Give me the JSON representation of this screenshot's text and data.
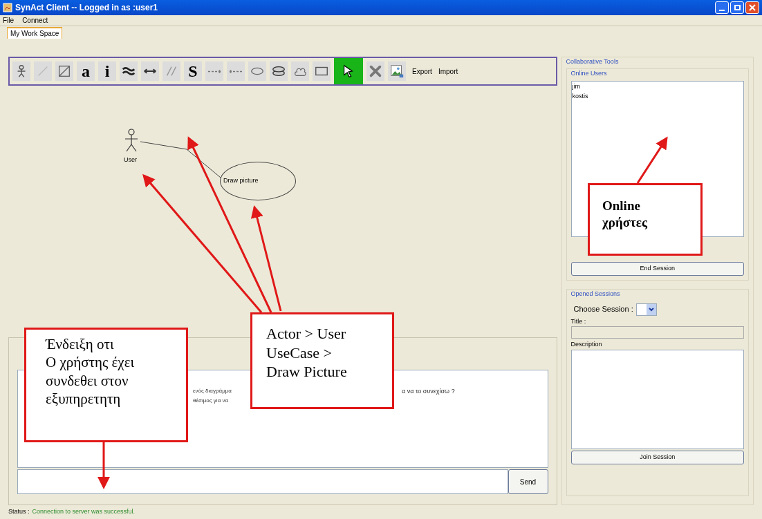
{
  "window": {
    "title": "SynAct Client -- Logged in as :user1"
  },
  "menu": [
    "File",
    "Connect"
  ],
  "tabs": [
    {
      "label": "My Work Space",
      "selected": true
    }
  ],
  "toolbar": [
    {
      "kind": "actor",
      "selected": false
    },
    {
      "kind": "faint-line",
      "selected": false
    },
    {
      "kind": "diagonal",
      "selected": false
    },
    {
      "kind": "glyph",
      "label": "a",
      "selected": false
    },
    {
      "kind": "glyph",
      "label": "i",
      "selected": false
    },
    {
      "kind": "wave",
      "selected": false
    },
    {
      "kind": "double-arrow",
      "selected": false
    },
    {
      "kind": "slashes",
      "selected": false
    },
    {
      "kind": "glyph",
      "label": "S",
      "selected": false
    },
    {
      "kind": "arrow-right",
      "selected": false
    },
    {
      "kind": "arrow-left",
      "selected": false
    },
    {
      "kind": "ellipse",
      "selected": false
    },
    {
      "kind": "stack",
      "selected": false
    },
    {
      "kind": "cloud",
      "selected": false
    },
    {
      "kind": "rectangle",
      "selected": false
    },
    {
      "kind": "pointer",
      "selected": true
    },
    {
      "kind": "delete",
      "selected": false
    },
    {
      "kind": "image",
      "selected": false
    }
  ],
  "toolbar_links": [
    "Export",
    "Import"
  ],
  "diagram": {
    "actor": "User",
    "usecase": "Draw picture"
  },
  "chat": {
    "lines": [
      {
        "left": "ενός διαγράμμα",
        "right": "α να το συνεχίσω ?"
      },
      {
        "left": "θέσιμος για να"
      }
    ],
    "send": "Send"
  },
  "status": {
    "label": "Status :",
    "message": "Connection to server was successful."
  },
  "collab": {
    "title": "Collaborative Tools",
    "online_title": "Online Users",
    "users": [
      "jim",
      "kostis"
    ],
    "end": "End Session",
    "sessions_title": "Opened Sessions",
    "choose": "Choose Session :",
    "title_label": "Title :",
    "description_label": "Description",
    "join": "Join Session"
  },
  "callouts": [
    {
      "kind": "plain",
      "lines": [
        "Ένδειξη οτι",
        "Ο χρήστης έχει",
        "συνδεθει στον",
        "εξυπηρετητη"
      ]
    },
    {
      "kind": "plain",
      "lines": [
        "Actor > User",
        "UseCase >",
        "Draw Picture"
      ]
    },
    {
      "kind": "bold",
      "lines": [
        "Online",
        "χρήστες"
      ]
    }
  ]
}
